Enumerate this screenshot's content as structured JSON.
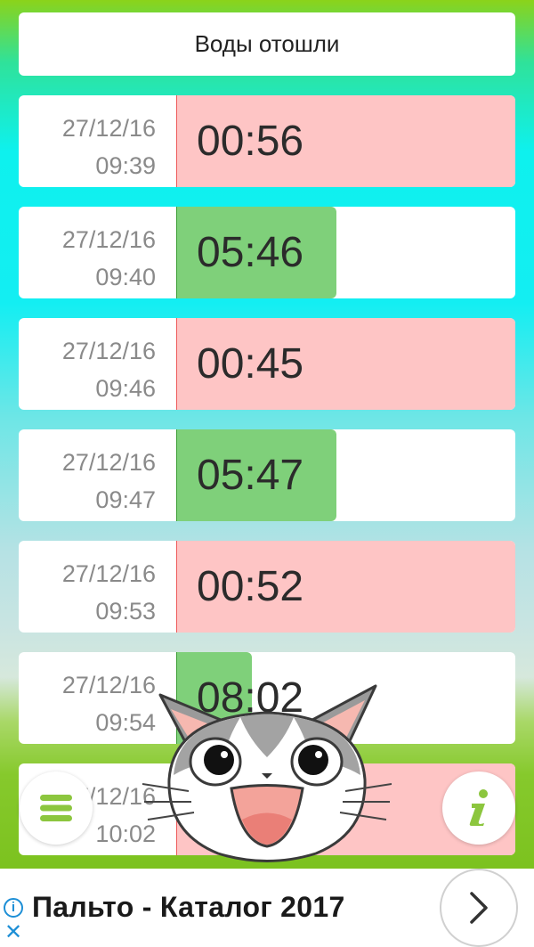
{
  "header": {
    "button_label": "Воды отошли"
  },
  "rows": [
    {
      "date": "27/12/16",
      "time": "09:39",
      "duration": "00:56",
      "type": "red",
      "fill": 1.0
    },
    {
      "date": "27/12/16",
      "time": "09:40",
      "duration": "05:46",
      "type": "green",
      "fill": 0.47
    },
    {
      "date": "27/12/16",
      "time": "09:46",
      "duration": "00:45",
      "type": "red",
      "fill": 1.0
    },
    {
      "date": "27/12/16",
      "time": "09:47",
      "duration": "05:47",
      "type": "green",
      "fill": 0.47
    },
    {
      "date": "27/12/16",
      "time": "09:53",
      "duration": "00:52",
      "type": "red",
      "fill": 1.0
    },
    {
      "date": "27/12/16",
      "time": "09:54",
      "duration": "08:02",
      "type": "green",
      "fill": 0.22
    },
    {
      "date": "27/12/16",
      "time": "10:02",
      "duration": "",
      "type": "red",
      "fill": 1.0
    }
  ],
  "colors": {
    "contraction": "#fec5c5",
    "interval": "#7fd07a",
    "accent": "#8cc63e"
  },
  "icons": {
    "menu": "menu-icon",
    "info": "info-icon",
    "mascot": "cat-mascot",
    "ad_next": "chevron-right-icon"
  },
  "ad": {
    "title": "Пальто - Каталог 2017",
    "info_glyph": "i",
    "close_glyph": "✕"
  }
}
